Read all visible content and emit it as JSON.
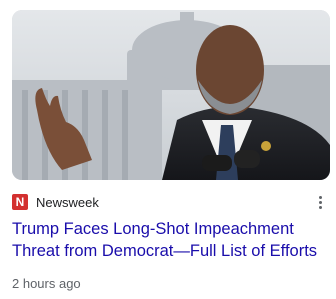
{
  "article": {
    "image_alt_icon": "news-photo",
    "source": {
      "name": "Newsweek",
      "logo_letter": "N",
      "logo_color": "#d3302f"
    },
    "headline": "Trump Faces Long-Shot Impeachment Threat from Democrat—Full List of Efforts",
    "timestamp": "2 hours ago",
    "headline_color": "#1a0dab",
    "more_icon": "more-vert-icon"
  }
}
